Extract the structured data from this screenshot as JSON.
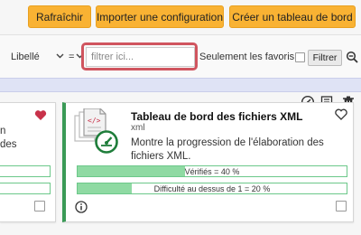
{
  "toolbar": {
    "refresh_label": "Rafraîchir",
    "import_label": "Importer une configuration",
    "create_label": "Créer un tableau de bord",
    "accent_color": "#f9b233"
  },
  "filter": {
    "field_value": "Libellé",
    "operator_value": "=",
    "search_placeholder": "filtrer ici...",
    "favorites_label": "Seulement les favoris =",
    "filter_button": "Filtrer",
    "highlight_color": "#d0555f"
  },
  "actions": {
    "icons": [
      "gauge-icon",
      "export-list-icon",
      "trash-icon"
    ]
  },
  "left_card": {
    "partial_text_1": "n",
    "partial_text_2": "des"
  },
  "card": {
    "title": "Tableau de bord des fichiers XML",
    "subtitle": "xml",
    "description": "Montre la progression de l'élaboration des fichiers XML.",
    "accent_color": "#3a9a56",
    "progress": [
      {
        "label": "Vérifiés = 40 %",
        "fraction": 0.4
      },
      {
        "label": "Difficulté au dessus de 1 = 20 %",
        "fraction": 0.2
      }
    ]
  }
}
